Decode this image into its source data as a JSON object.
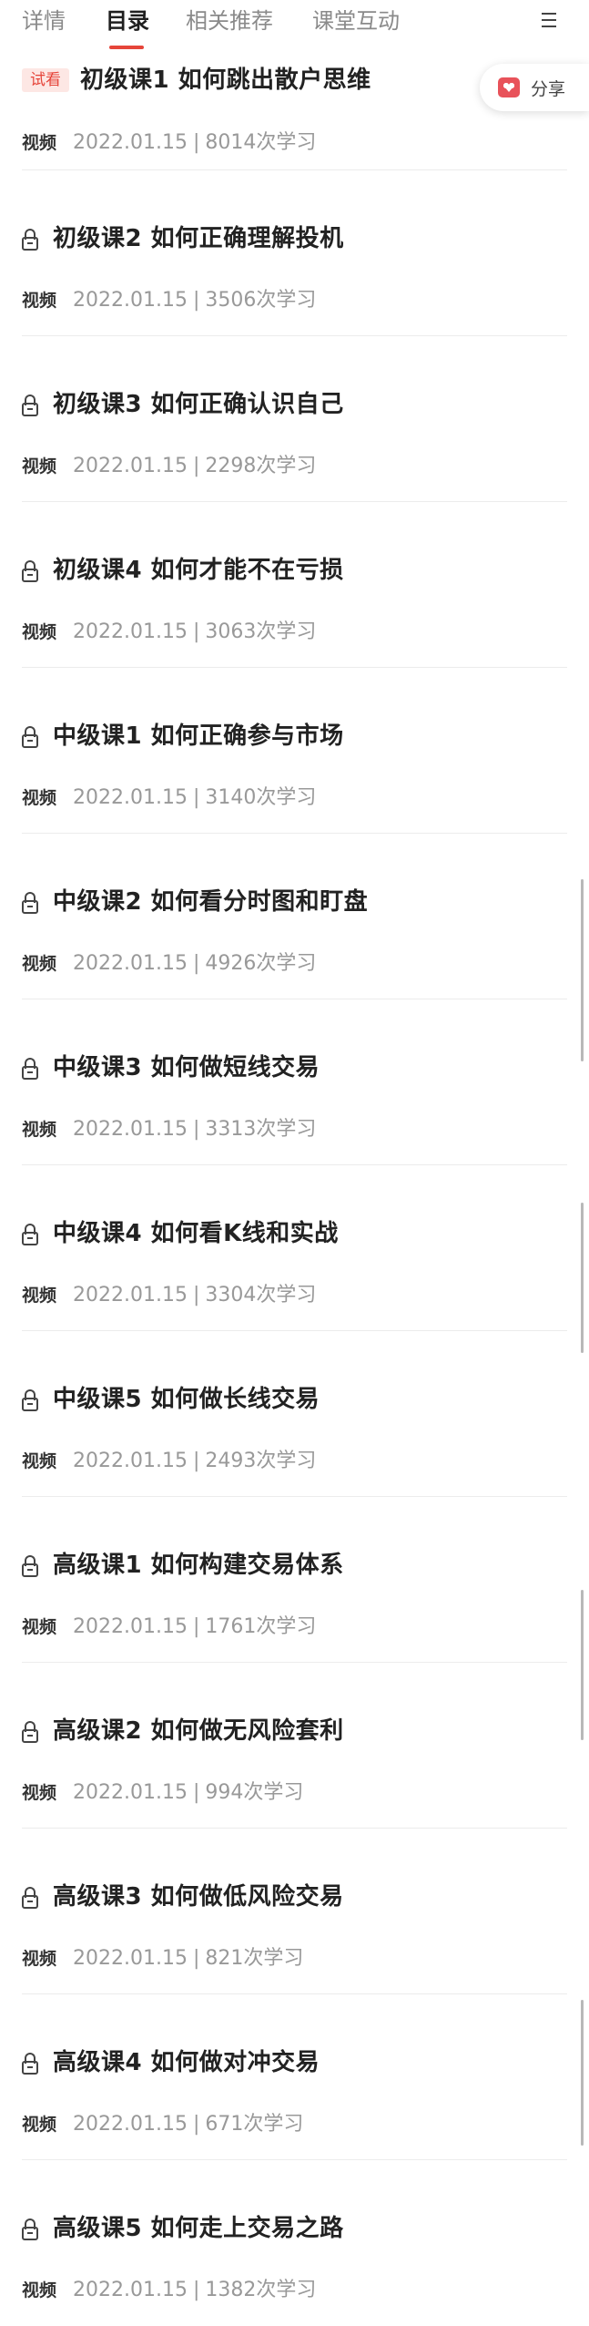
{
  "tabs": [
    {
      "label": "详情",
      "active": false
    },
    {
      "label": "目录",
      "active": true
    },
    {
      "label": "相关推荐",
      "active": false
    },
    {
      "label": "课堂互动",
      "active": false
    }
  ],
  "tab_more_icon": "menu-more-icon",
  "accent_color": "#e6453a",
  "share": {
    "label": "分享",
    "icon": "share-heart-icon",
    "icon_color": "#e8525a"
  },
  "lessons": [
    {
      "title": "初级课1 如何跳出散户思维",
      "badge": "试看",
      "type": "视频",
      "date": "2022.01.15",
      "separator": "|",
      "views": "8014次学习",
      "locked": false
    },
    {
      "title": "初级课2 如何正确理解投机",
      "type": "视频",
      "date": "2022.01.15",
      "separator": "|",
      "views": "3506次学习",
      "locked": true
    },
    {
      "title": "初级课3 如何正确认识自己",
      "type": "视频",
      "date": "2022.01.15",
      "separator": "|",
      "views": "2298次学习",
      "locked": true
    },
    {
      "title": "初级课4 如何才能不在亏损",
      "type": "视频",
      "date": "2022.01.15",
      "separator": "|",
      "views": "3063次学习",
      "locked": true
    },
    {
      "title": "中级课1 如何正确参与市场",
      "type": "视频",
      "date": "2022.01.15",
      "separator": "|",
      "views": "3140次学习",
      "locked": true
    },
    {
      "title": "中级课2 如何看分时图和盯盘",
      "type": "视频",
      "date": "2022.01.15",
      "separator": "|",
      "views": "4926次学习",
      "locked": true
    },
    {
      "title": "中级课3 如何做短线交易",
      "type": "视频",
      "date": "2022.01.15",
      "separator": "|",
      "views": "3313次学习",
      "locked": true
    },
    {
      "title": "中级课4 如何看K线和实战",
      "type": "视频",
      "date": "2022.01.15",
      "separator": "|",
      "views": "3304次学习",
      "locked": true
    },
    {
      "title": "中级课5 如何做长线交易",
      "type": "视频",
      "date": "2022.01.15",
      "separator": "|",
      "views": "2493次学习",
      "locked": true
    },
    {
      "title": "高级课1 如何构建交易体系",
      "type": "视频",
      "date": "2022.01.15",
      "separator": "|",
      "views": "1761次学习",
      "locked": true
    },
    {
      "title": "高级课2 如何做无风险套利",
      "type": "视频",
      "date": "2022.01.15",
      "separator": "|",
      "views": "994次学习",
      "locked": true
    },
    {
      "title": "高级课3 如何做低风险交易",
      "type": "视频",
      "date": "2022.01.15",
      "separator": "|",
      "views": "821次学习",
      "locked": true
    },
    {
      "title": "高级课4 如何做对冲交易",
      "type": "视频",
      "date": "2022.01.15",
      "separator": "|",
      "views": "671次学习",
      "locked": true
    },
    {
      "title": "高级课5 如何走上交易之路",
      "type": "视频",
      "date": "2022.01.15",
      "separator": "|",
      "views": "1382次学习",
      "locked": true
    }
  ]
}
